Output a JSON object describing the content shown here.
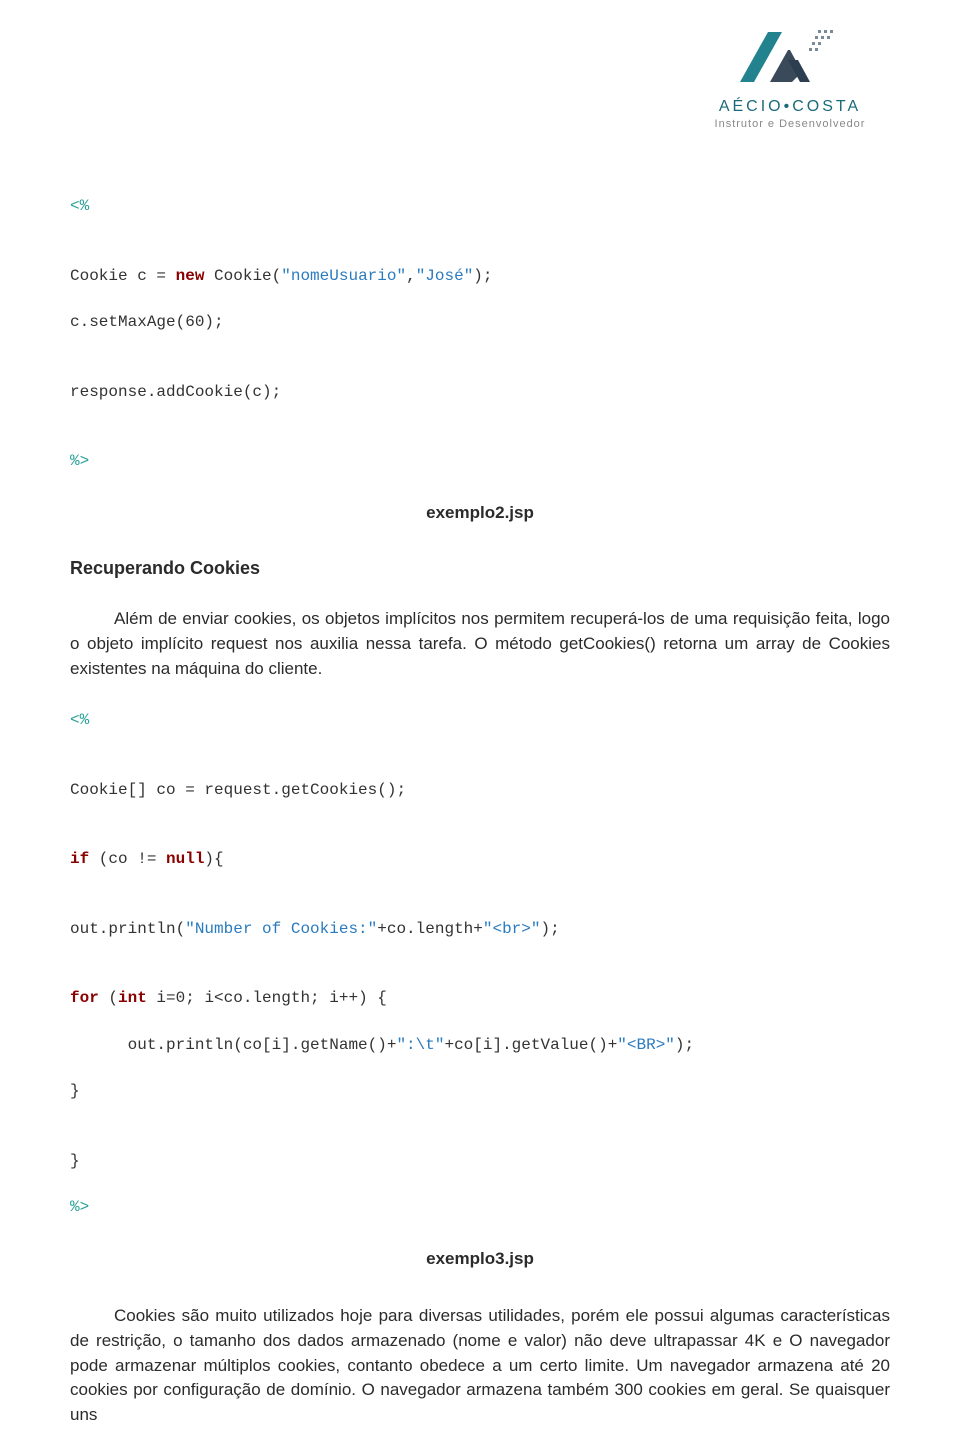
{
  "logo": {
    "brand_first": "AÉCIO",
    "brand_dot": "•",
    "brand_last": "COSTA",
    "tagline": "Instrutor e Desenvolvedor"
  },
  "code1": {
    "open": "<%",
    "l1_a": "Cookie c = ",
    "l1_kw": "new",
    "l1_b": " Cookie(",
    "l1_s1": "\"nomeUsuario\"",
    "l1_c": ",",
    "l1_s2": "\"José\"",
    "l1_d": ");",
    "l2": "c.setMaxAge(60);",
    "l3": "response.addCookie(c);",
    "close": "%>"
  },
  "caption1": "exemplo2.jsp",
  "heading1": "Recuperando Cookies",
  "para1": "Além de enviar cookies, os objetos implícitos nos permitem recuperá-los de uma requisição feita, logo o objeto implícito request nos auxilia nessa tarefa. O método getCookies() retorna um array de Cookies existentes na máquina do cliente.",
  "code2": {
    "open": "<%",
    "l1": "Cookie[] co = request.getCookies();",
    "l2_kw": "if",
    "l2_a": " (co != ",
    "l2_kw2": "null",
    "l2_b": "){",
    "l3_a": "out.println(",
    "l3_s": "\"Number of Cookies:\"",
    "l3_b": "+co.length+",
    "l3_s2": "\"<br>\"",
    "l3_c": ");",
    "l4_kw": "for",
    "l4_a": " (",
    "l4_kw2": "int",
    "l4_b": " i=0; i<co.length; i++) {",
    "l5_a": "      out.println(co[i].getName()+",
    "l5_s": "\":\\t\"",
    "l5_b": "+co[i].getValue()+",
    "l5_s2": "\"<BR>\"",
    "l5_c": ");",
    "l6": "}",
    "l7": "}",
    "close": "%>"
  },
  "caption2": "exemplo3.jsp",
  "para2": "Cookies são muito utilizados hoje para diversas utilidades, porém ele possui algumas características de restrição, o tamanho dos dados armazenado (nome e valor) não deve ultrapassar 4K e O navegador pode armazenar múltiplos cookies, contanto obedece a um certo limite. Um navegador armazena até 20 cookies por configuração de domínio. O navegador armazena também 300 cookies em geral. Se quaisquer uns"
}
